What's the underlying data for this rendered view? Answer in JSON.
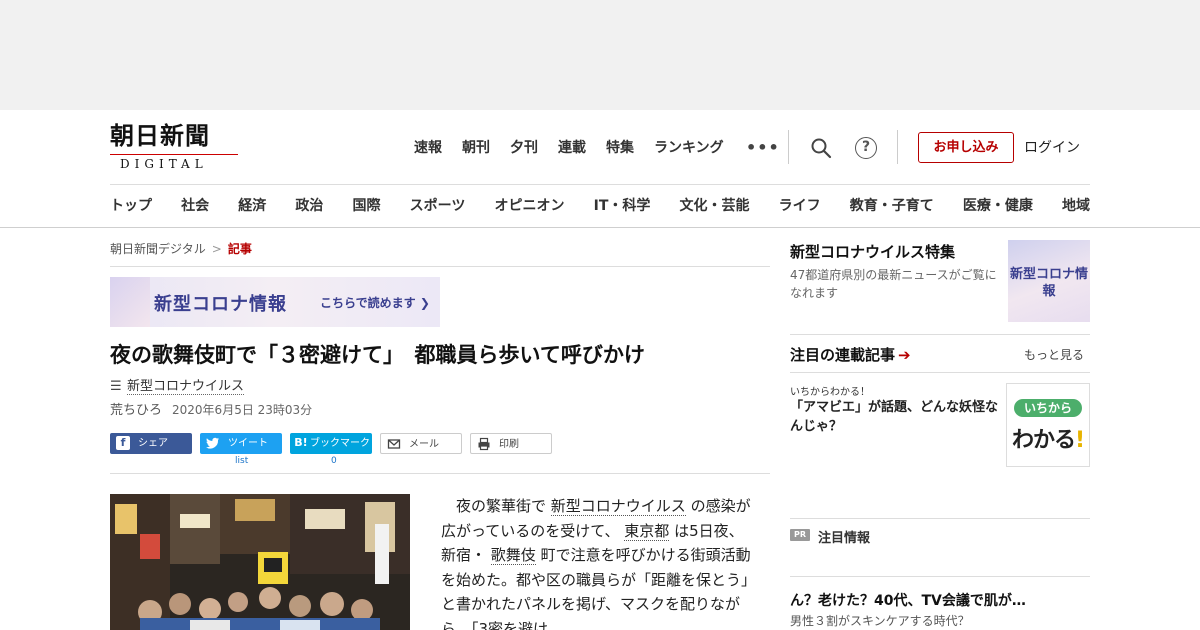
{
  "logo": {
    "main": "朝日新聞",
    "sub": "DIGITAL"
  },
  "topnav": [
    "速報",
    "朝刊",
    "夕刊",
    "連載",
    "特集",
    "ランキング"
  ],
  "header": {
    "more": "•••",
    "help": "?",
    "signup": "お申し込み",
    "login": "ログイン"
  },
  "catnav": [
    "トップ",
    "社会",
    "経済",
    "政治",
    "国際",
    "スポーツ",
    "オピニオン",
    "IT・科学",
    "文化・芸能",
    "ライフ",
    "教育・子育て",
    "医療・健康",
    "地域"
  ],
  "breadcrumb": {
    "home": "朝日新聞デジタル",
    "sep": ">",
    "current": "記事"
  },
  "banner": {
    "title": "新型コロナ情報",
    "sub": "こちらで読めます ❯"
  },
  "article": {
    "headline": "夜の歌舞伎町で「３密避けて」　都職員ら歩いて呼びかけ",
    "topic": "新型コロナウイルス",
    "author": "荒ちひろ",
    "date": "2020年6月5日 23時03分",
    "body": {
      "p1a": "夜の繁華街で",
      "link1": "新型コロナウイルス",
      "p1b": "の感染が広がっているのを受けて、",
      "link2": "東京都",
      "p1c": "は5日夜、新宿・",
      "link3": "歌舞伎",
      "p1d": "町で注意を呼びかける街頭活動を始めた。都や区の職員らが「距離を保とう」と書かれたパネルを掲げ、マスクを配りながら、「3密を避け"
    }
  },
  "share": {
    "facebook": "シェア",
    "twitter": "ツイート",
    "hatena_icon": "B!",
    "hatena": "ブックマーク",
    "mail": "メール",
    "print": "印刷",
    "twitter_count": "list",
    "hatena_count": "0"
  },
  "sidebar": {
    "feature_title": "新型コロナウイルス特集",
    "feature_desc": "47都道府県別の最新ニュースがご覧になれます",
    "feature_thumb": "新型コロナ情報",
    "series_title": "注目の連載記事",
    "series_arrow": "➔",
    "more": "もっと見る",
    "kicker": "いちからわかる！",
    "article": "「アマビエ」が話題、どんな妖怪なんじゃ？",
    "thumb_pill": "いちから",
    "thumb_big": "わかる",
    "thumb_bang": "!",
    "pr_badge": "PR",
    "pr_title": "注目情報",
    "pr_item_title": "ん？老けた？40代、TV会議で肌が…",
    "pr_item_desc": "男性３割がスキンケアする時代？"
  }
}
